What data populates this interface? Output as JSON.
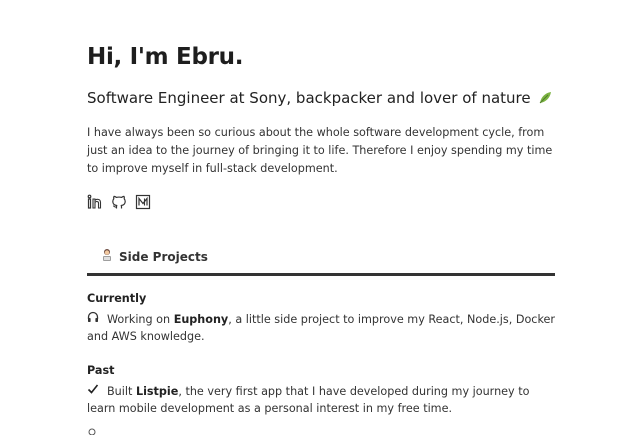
{
  "hero": {
    "title": "Hi, I'm Ebru.",
    "subtitle": "Software Engineer at Sony, backpacker and lover of nature",
    "bio": "I have always been so curious about the whole software development cycle, from just an idea to the journey of bringing it to life. Therefore I enjoy spending my time to improve myself in full-stack development."
  },
  "socials": [
    {
      "icon": "linkedin-icon"
    },
    {
      "icon": "github-icon"
    },
    {
      "icon": "medium-icon"
    }
  ],
  "tabs": {
    "side_projects": "Side Projects"
  },
  "sections": {
    "currently": {
      "heading": "Currently",
      "icon": "headphones-icon",
      "prefix": "Working on ",
      "project": "Euphony",
      "suffix": ", a little side project to improve my React, Node.js, Docker and AWS knowledge."
    },
    "past": {
      "heading": "Past",
      "icon": "checkmark-icon",
      "prefix": "Built ",
      "project": "Listpie",
      "suffix": ", the very first app that I have developed during my journey to learn mobile development as a personal interest in my free time."
    }
  },
  "colors": {
    "text": "#333333",
    "rule": "#333333",
    "leaf": "#6aa84f"
  }
}
